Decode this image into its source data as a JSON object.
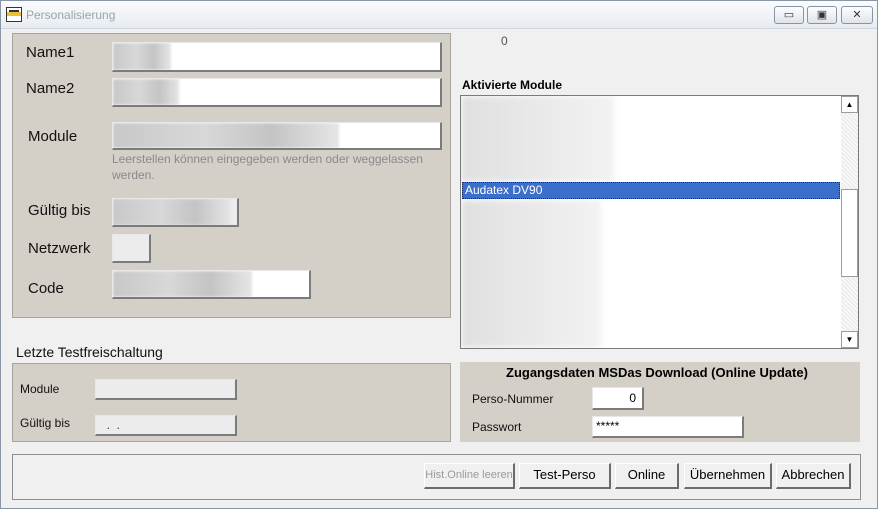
{
  "window": {
    "title": "Personalisierung",
    "min_glyph": "▭",
    "max_glyph": "▣",
    "close_glyph": "✕"
  },
  "top_counter": "0",
  "personal": {
    "name1_label": "Name1",
    "name2_label": "Name2",
    "module_label": "Module",
    "module_hint": "Leerstellen können eingegeben werden oder weggelassen werden.",
    "valid_label": "Gültig bis",
    "network_label": "Netzwerk",
    "code_label": "Code"
  },
  "test": {
    "section_title": "Letzte Testfreischaltung",
    "module_label": "Module",
    "valid_label": "Gültig bis",
    "valid_value": "  .  ."
  },
  "modules": {
    "title": "Aktivierte Module",
    "selected_item": "Audatex DV90",
    "scroll_up": "▲",
    "scroll_down": "▼"
  },
  "download": {
    "title": "Zugangsdaten MSDas Download (Online Update)",
    "perso_label": "Perso-Nummer",
    "perso_value": "0",
    "password_label": "Passwort",
    "password_value": "*****"
  },
  "buttons": {
    "hist_online": "Hist.Online leeren",
    "test_perso": "Test-Perso",
    "online": "Online",
    "uebernehmen": "Übernehmen",
    "abbrechen": "Abbrechen"
  }
}
